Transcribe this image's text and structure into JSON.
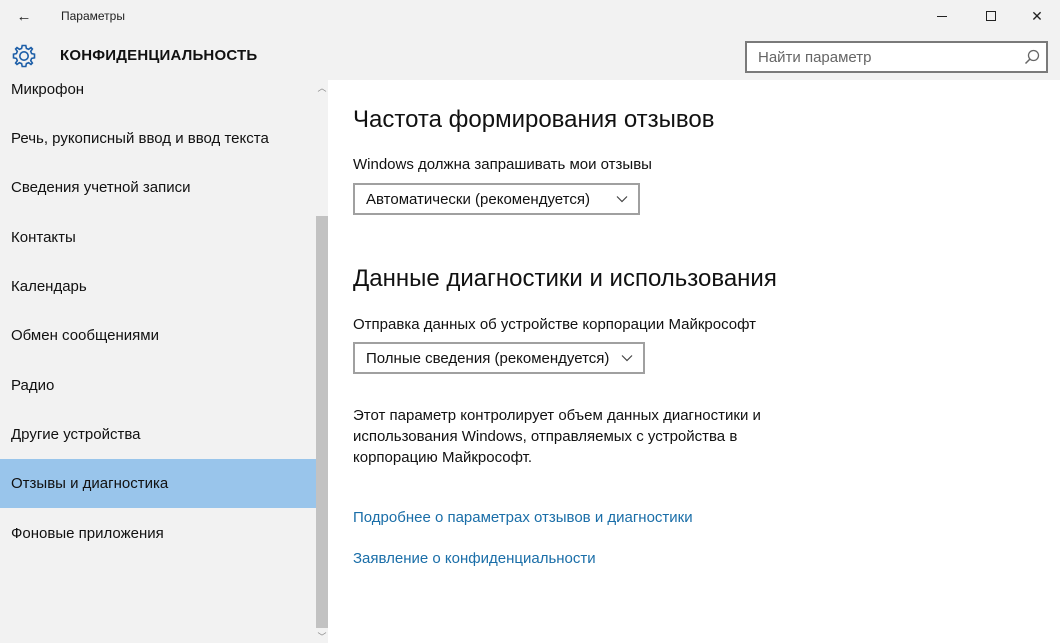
{
  "window": {
    "app_title": "Параметры",
    "back_icon": "back-arrow-icon",
    "minimize_icon": "minimize-icon",
    "maximize_icon": "maximize-icon",
    "close_icon": "close-icon",
    "close_glyph": "✕",
    "back_glyph": "←"
  },
  "header": {
    "icon": "gear-icon",
    "title": "КОНФИДЕНЦИАЛЬНОСТЬ",
    "search_placeholder": "Найти параметр",
    "search_icon": "search-icon"
  },
  "sidebar": {
    "items": [
      {
        "label": "Микрофон",
        "active": false
      },
      {
        "label": "Речь, рукописный ввод и ввод текста",
        "active": false
      },
      {
        "label": "Сведения учетной записи",
        "active": false
      },
      {
        "label": "Контакты",
        "active": false
      },
      {
        "label": "Календарь",
        "active": false
      },
      {
        "label": "Обмен сообщениями",
        "active": false
      },
      {
        "label": "Радио",
        "active": false
      },
      {
        "label": "Другие устройства",
        "active": false
      },
      {
        "label": "Отзывы и диагностика",
        "active": true
      },
      {
        "label": "Фоновые приложения",
        "active": false
      }
    ],
    "active_color": "#99c5eb"
  },
  "main": {
    "feedback": {
      "heading": "Частота формирования отзывов",
      "label": "Windows должна запрашивать мои отзывы",
      "selected": "Автоматически (рекомендуется)"
    },
    "diagnostics": {
      "heading": "Данные диагностики и использования",
      "label": "Отправка данных об устройстве корпорации Майкрософт",
      "selected": "Полные сведения (рекомендуется)",
      "description": "Этот параметр контролирует объем данных диагностики и использования Windows, отправляемых с устройства в корпорацию Майкрософт."
    },
    "links": {
      "more": "Подробнее о параметрах отзывов и диагностики",
      "privacy": "Заявление о конфиденциальности"
    },
    "link_color": "#1a6ea8"
  }
}
